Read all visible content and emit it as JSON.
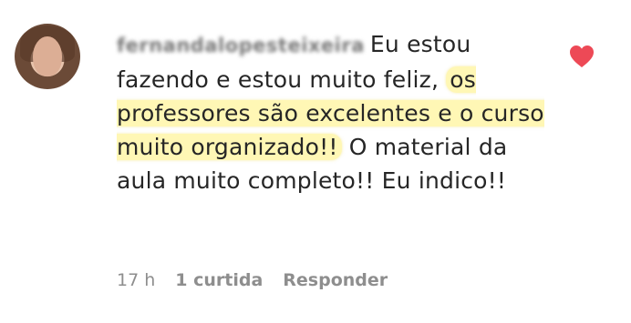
{
  "comment": {
    "username": "fernandalopesteixeira",
    "text_before_highlight": "Eu estou fazendo e estou muito feliz, ",
    "highlighted_text": "os professores são excelentes e o curso muito organizado!!",
    "text_after_highlight": " O material da aula muito completo!! Eu indico!!",
    "liked": true,
    "heart_color": "#ed4956",
    "highlight_color": "#fff078"
  },
  "meta": {
    "timestamp": "17 h",
    "likes": "1 curtida",
    "reply_label": "Responder"
  },
  "icons": {
    "avatar": "avatar-photo",
    "like": "heart-icon"
  }
}
